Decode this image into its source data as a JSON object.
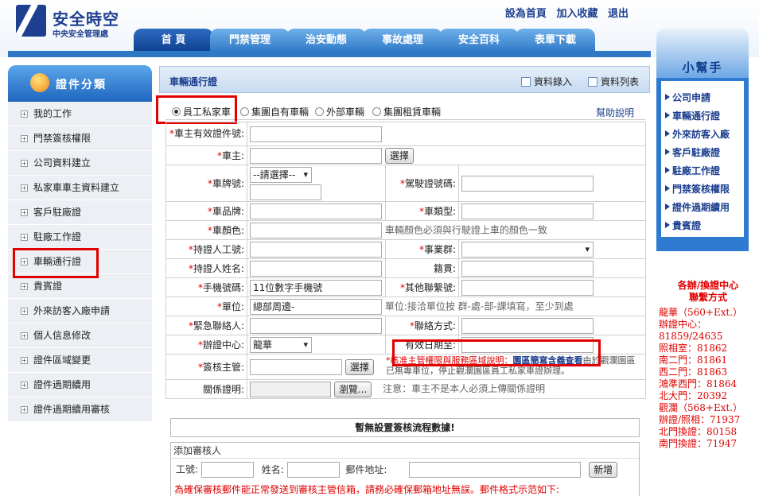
{
  "header": {
    "logo_title": "安全時空",
    "logo_subtitle": "中央安全管理處",
    "links": [
      "設為首頁",
      "加入收藏",
      "退出"
    ]
  },
  "nav": {
    "tabs": [
      "首 頁",
      "門禁管理",
      "治安動態",
      "事故處理",
      "安全百科",
      "表單下載"
    ]
  },
  "sidebar": {
    "title": "證件分類",
    "items": [
      "我的工作",
      "門禁簽核權限",
      "公司資料建立",
      "私家車車主資料建立",
      "客戶駐廠證",
      "駐廠工作證",
      "車輛通行證",
      "貴賓證",
      "外來訪客入廠申請",
      "個人信息修改",
      "證件區域變更",
      "證件過期續用",
      "證件過期續用審核"
    ]
  },
  "main": {
    "title": "車輛通行證",
    "action_add": "資料錄入",
    "action_list": "資料列表",
    "radio_options": [
      "員工私家車",
      "集團自有車輛",
      "外部車輛",
      "集團租賃車輛"
    ],
    "help": "幫助說明",
    "form": {
      "valid_id": "車主有效證件號:",
      "owner": "車主:",
      "select_btn": "選擇",
      "plate": "車牌號:",
      "plate_select": "--請選擇--",
      "license": "駕駛證號碼:",
      "brand": "車品牌:",
      "car_type": "車類型:",
      "color": "車顏色:",
      "color_note": "車輛顏色必須與行駛證上車的顏色一致",
      "holder_no": "持證人工號:",
      "business_group": "事業群:",
      "holder_name": "持證人姓名:",
      "native_place": "籍貫:",
      "mobile": "手機號碼:",
      "mobile_value": "11位數字手機號",
      "other_contact": "其他聯繫號:",
      "unit": "單位:",
      "unit_value": "總部周邊-",
      "unit_note": "單位:接洽單位按 群-處-部-課填寫，至少到處",
      "emergency": "緊急聯絡人:",
      "contact_method": "聯絡方式:",
      "center": "辦證中心:",
      "center_value": "龍華",
      "valid_date": "有效日期至:",
      "approver": "簽核主管:",
      "approver_note_pre": "*核准主管權限與服務區域說明：",
      "approver_note_link": "園區簡寫含義查看",
      "approver_note_post": "由於觀瀾園區已無專車位，停止觀瀾園區員工私家車證辦理。",
      "relation": "關係證明:",
      "browse": "瀏覽...",
      "relation_note": "注意：車主不是本人必須上傳關係證明"
    },
    "flow_notice": "暫無設置簽核流程數據!",
    "add_reviewer": {
      "title": "添加審核人",
      "emp_no": "工號:",
      "name": "姓名:",
      "email": "郵件地址:",
      "add_btn": "新增",
      "warning": "為確保審核郵件能正常發送到審核主管信箱，請務必確保郵箱地址無誤。郵件格式示范如下:"
    }
  },
  "helper": {
    "title": "小幫手",
    "items": [
      "公司申請",
      "車輛通行證",
      "外來訪客入廠",
      "客戶駐廠證",
      "駐廠工作證",
      "門禁簽核權限",
      "證件過期續用",
      "貴賓證"
    ]
  },
  "contact": {
    "title1": "各辦/換證中心",
    "title2": "聯繫方式",
    "lines": [
      "龍華（560+Ext.）",
      "辦證中心：",
      "81859/24635",
      "照相室：81862",
      "南二門：81861",
      "西二門：81863",
      "鴻準西門：81864",
      "北大門：20392",
      "觀瀾（568+Ext.）",
      "辦證/照相：71937",
      "北門換證：80158",
      "南門換證：71947"
    ]
  }
}
